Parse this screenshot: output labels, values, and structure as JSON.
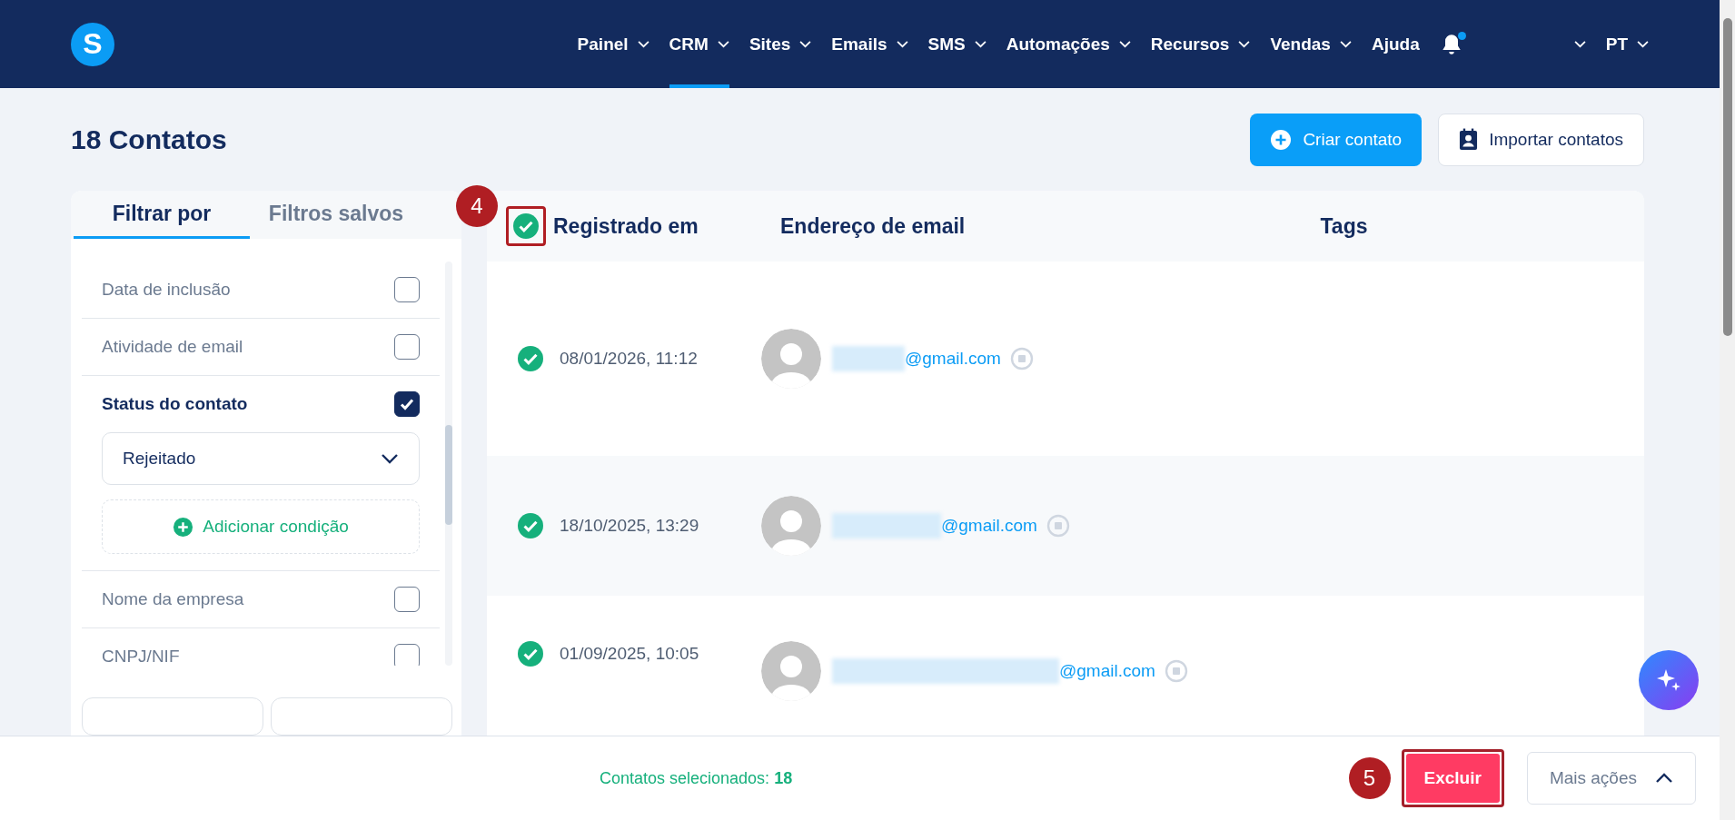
{
  "header": {
    "logo": "S",
    "nav": [
      {
        "label": "Painel",
        "selected": false,
        "dropdown": true
      },
      {
        "label": "CRM",
        "selected": true,
        "dropdown": true
      },
      {
        "label": "Sites",
        "selected": false,
        "dropdown": true
      },
      {
        "label": "Emails",
        "selected": false,
        "dropdown": true
      },
      {
        "label": "SMS",
        "selected": false,
        "dropdown": true
      },
      {
        "label": "Automações",
        "selected": false,
        "dropdown": true
      },
      {
        "label": "Recursos",
        "selected": false,
        "dropdown": true
      },
      {
        "label": "Vendas",
        "selected": false,
        "dropdown": true
      },
      {
        "label": "Ajuda",
        "selected": false,
        "dropdown": false
      }
    ],
    "notification": true,
    "language": "PT"
  },
  "page_title": "18 Contatos",
  "actions": [
    {
      "label": "Criar contato",
      "kind": "primary"
    },
    {
      "label": "Importar contatos",
      "kind": "secondary"
    }
  ],
  "filter_tabs": [
    {
      "label": "Filtrar por",
      "selected": true
    },
    {
      "label": "Filtros salvos",
      "selected": false
    }
  ],
  "filters": [
    {
      "label": "Data de inclusão",
      "checked": false
    },
    {
      "label": "Atividade de email",
      "checked": false
    },
    {
      "label": "Status do contato",
      "checked": true,
      "value": "Rejeitado",
      "add_label": "Adicionar condição"
    },
    {
      "label": "Nome da empresa",
      "checked": false
    },
    {
      "label": "CNPJ/NIF",
      "checked": false
    }
  ],
  "table": {
    "all_selected": true,
    "annotation": "4",
    "columns": [
      "Registrado em",
      "Endereço de email",
      "Tags"
    ],
    "rows": [
      {
        "selected": true,
        "date": "08/01/2026, 11:12",
        "email": "@gmail.com"
      },
      {
        "selected": true,
        "date": "18/10/2025, 13:29",
        "email": "@gmail.com"
      },
      {
        "selected": true,
        "date": "01/09/2025, 10:05",
        "email": "@gmail.com"
      }
    ]
  },
  "footer": {
    "selected_label": "Contatos selecionados:",
    "selected_count": "18",
    "delete_label": "Excluir",
    "delete_annotation": "5",
    "more_label": "Mais ações"
  }
}
